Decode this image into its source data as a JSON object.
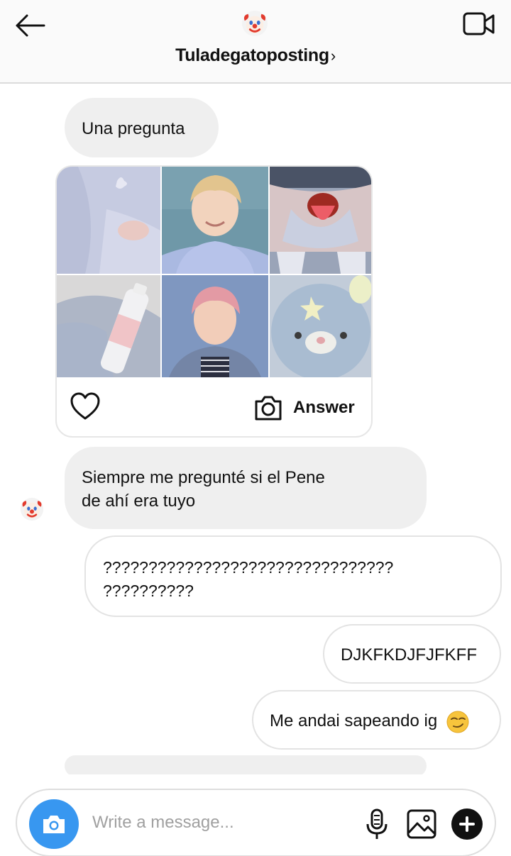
{
  "header": {
    "title": "Tuladegatoposting",
    "chevron": "›",
    "icons": {
      "back": "back-arrow-icon",
      "avatar": "clown-face-avatar",
      "video": "video-camera-icon"
    }
  },
  "messages": [
    {
      "direction": "incoming",
      "text": "Una pregunta"
    },
    {
      "direction": "incoming",
      "type": "shared-post",
      "answer_label": "Answer"
    },
    {
      "direction": "incoming",
      "text_line1": "Siempre me pregunté si el Pene",
      "text_line2": "de ahí era tuyo"
    },
    {
      "direction": "outgoing",
      "text_line1": "????????????????????????????????",
      "text_line2": "??????????"
    },
    {
      "direction": "outgoing",
      "text": "DJKFKDJFJFKFF"
    },
    {
      "direction": "outgoing",
      "text": "Me andai sapeando ig",
      "emoji": "smirking-face"
    }
  ],
  "composer": {
    "placeholder": "Write a message...",
    "icons": [
      "camera-icon",
      "microphone-icon",
      "gallery-icon",
      "plus-icon"
    ]
  },
  "colors": {
    "accent": "#3897f0",
    "incoming_bubble": "#efefef",
    "outgoing_border": "#e3e3e3"
  }
}
